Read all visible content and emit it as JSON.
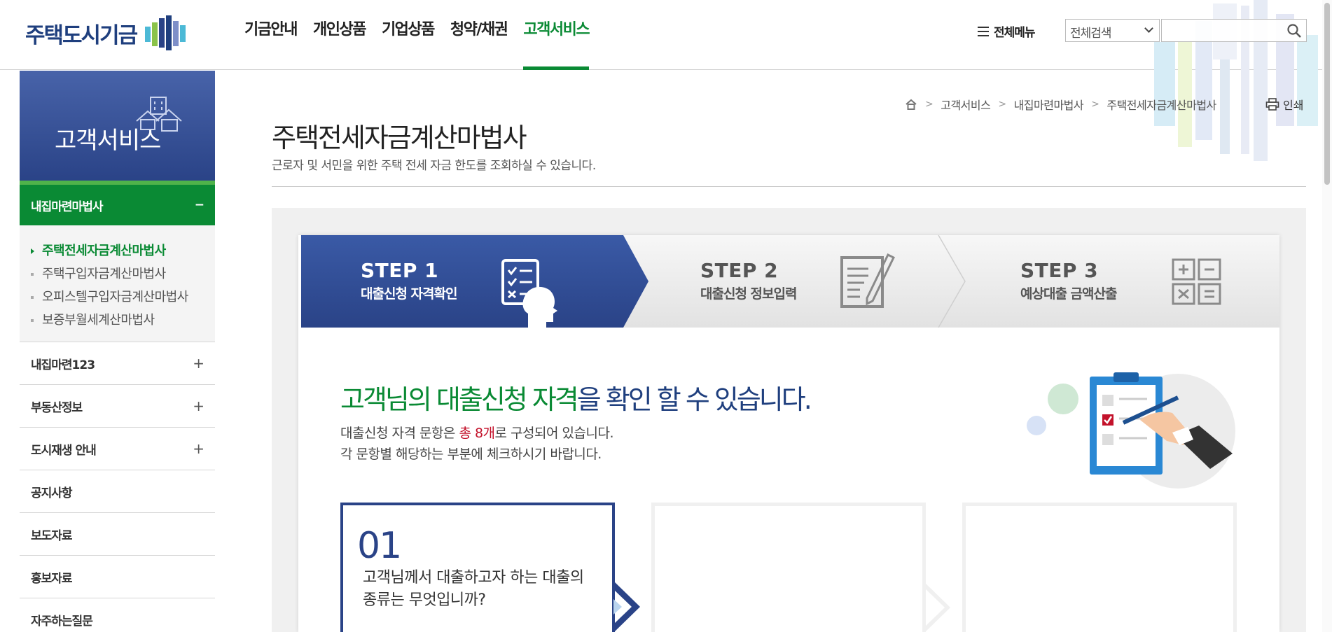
{
  "header": {
    "logo_text": "주택도시기금",
    "nav": [
      "기금안내",
      "개인상품",
      "기업상품",
      "청약/채권",
      "고객서비스"
    ],
    "all_menu_label": "전체메뉴",
    "search_scope": "전체검색",
    "search_value": ""
  },
  "lnb": {
    "title": "고객서비스",
    "open_group": {
      "label": "내집마련마법사",
      "sign": "−"
    },
    "sub_items": [
      "주택전세자금계산마법사",
      "주택구입자금계산마법사",
      "오피스텔구입자금계산마법사",
      "보증부월세계산마법사"
    ],
    "items": [
      {
        "label": "내집마련123",
        "sign": "+"
      },
      {
        "label": "부동산정보",
        "sign": "+"
      },
      {
        "label": "도시재생 안내",
        "sign": "+"
      },
      {
        "label": "공지사항",
        "sign": ""
      },
      {
        "label": "보도자료",
        "sign": ""
      },
      {
        "label": "홍보자료",
        "sign": ""
      },
      {
        "label": "자주하는질문",
        "sign": ""
      }
    ]
  },
  "breadcrumb": [
    "고객서비스",
    "내집마련마법사",
    "주택전세자금계산마법사"
  ],
  "print_label": "인쇄",
  "page": {
    "title": "주택전세자금계산마법사",
    "description": "근로자 및 서민을 위한 주택 전세 자금 한도를 조회하실 수 있습니다."
  },
  "steps": [
    {
      "number": "STEP 1",
      "label": "대출신청 자격확인",
      "active": true
    },
    {
      "number": "STEP 2",
      "label": "대출신청 정보입력",
      "active": false
    },
    {
      "number": "STEP 3",
      "label": "예상대출 금액산출",
      "active": false
    }
  ],
  "intro": {
    "title_part1": "고객님의 대출신청 자격",
    "title_part2": "을 확인 할 수 있습니다.",
    "desc1_a": "대출신청 자격 문항은 ",
    "desc1_red": "총 8개",
    "desc1_b": "로 구성되어 있습니다.",
    "desc2": "각 문항별 해당하는 부분에 체크하시기 바랍니다."
  },
  "questions": [
    {
      "number": "01",
      "text": "고객님께서 대출하고자 하는 대출의 종류는 무엇입니까?"
    }
  ],
  "colors": {
    "brand_navy": "#2a4387",
    "brand_green": "#0a8a34",
    "highlight_red": "#c3122b"
  }
}
